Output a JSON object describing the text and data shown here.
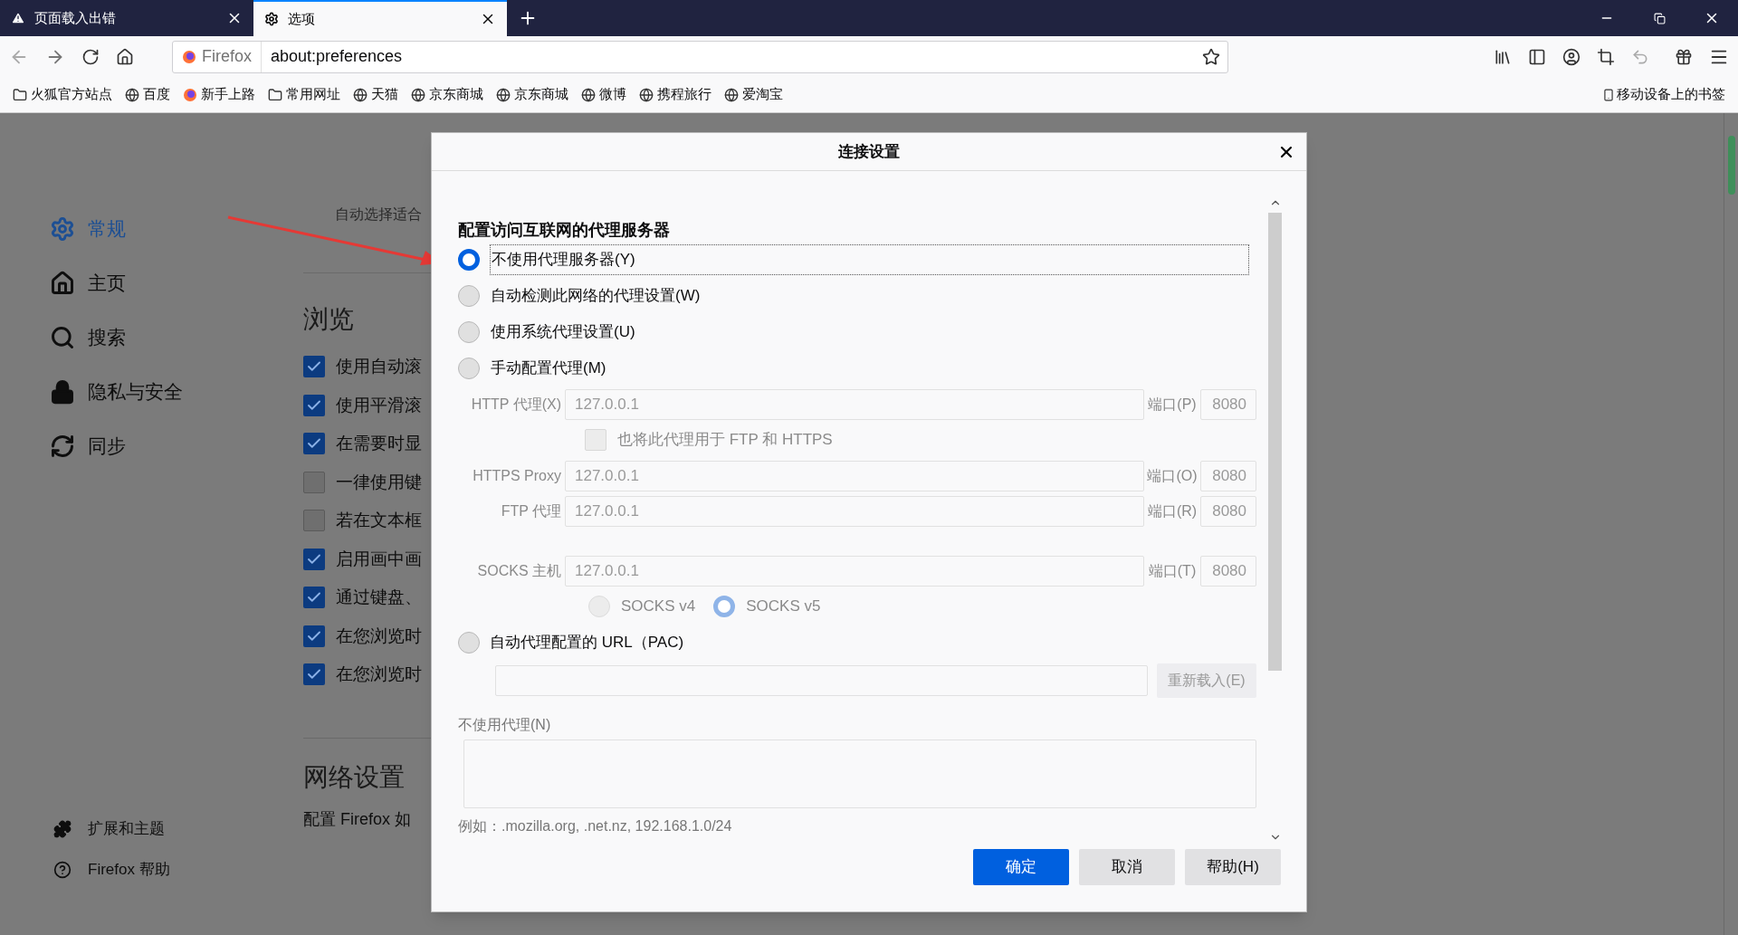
{
  "tabs": [
    {
      "title": "页面载入出错",
      "kind": "warning",
      "selected": false
    },
    {
      "title": "选项",
      "kind": "settings",
      "selected": true
    }
  ],
  "address_bar": {
    "identity": "Firefox",
    "url": "about:preferences"
  },
  "bookmarks": [
    {
      "label": "火狐官方站点",
      "kind": "folder"
    },
    {
      "label": "百度",
      "kind": "globe"
    },
    {
      "label": "新手上路",
      "kind": "firefox"
    },
    {
      "label": "常用网址",
      "kind": "folder"
    },
    {
      "label": "天猫",
      "kind": "globe"
    },
    {
      "label": "京东商城",
      "kind": "globe"
    },
    {
      "label": "京东商城",
      "kind": "globe"
    },
    {
      "label": "微博",
      "kind": "globe"
    },
    {
      "label": "携程旅行",
      "kind": "globe"
    },
    {
      "label": "爱淘宝",
      "kind": "globe"
    }
  ],
  "mobile_bookmarks": "移动设备上的书签",
  "sidebar": {
    "items": [
      {
        "label": "常规",
        "kind": "general",
        "selected": true
      },
      {
        "label": "主页",
        "kind": "home",
        "selected": false
      },
      {
        "label": "搜索",
        "kind": "search",
        "selected": false
      },
      {
        "label": "隐私与安全",
        "kind": "privacy",
        "selected": false
      },
      {
        "label": "同步",
        "kind": "sync",
        "selected": false
      }
    ],
    "footer": [
      {
        "label": "扩展和主题",
        "kind": "extensions"
      },
      {
        "label": "Firefox 帮助",
        "kind": "help"
      }
    ]
  },
  "page": {
    "intro": "自动选择适合",
    "browsing_heading": "浏览",
    "checkboxes": [
      {
        "label": "使用自动滚",
        "checked": true
      },
      {
        "label": "使用平滑滚",
        "checked": true
      },
      {
        "label": "在需要时显",
        "checked": true
      },
      {
        "label": "一律使用键",
        "checked": false
      },
      {
        "label": "若在文本框",
        "checked": false
      },
      {
        "label": "启用画中画",
        "checked": true
      },
      {
        "label": "通过键盘、",
        "checked": true
      },
      {
        "label": "在您浏览时",
        "checked": true
      },
      {
        "label": "在您浏览时",
        "checked": true
      }
    ],
    "network_heading": "网络设置",
    "network_text": "配置 Firefox 如"
  },
  "dialog": {
    "title": "连接设置",
    "heading": "配置访问互联网的代理服务器",
    "modes": [
      {
        "label": "不使用代理服务器(Y)",
        "selected": true
      },
      {
        "label": "自动检测此网络的代理设置(W)",
        "selected": false
      },
      {
        "label": "使用系统代理设置(U)",
        "selected": false
      },
      {
        "label": "手动配置代理(M)",
        "selected": false
      }
    ],
    "manual_disabled": true,
    "proxies": [
      {
        "kind": "http",
        "label": "HTTP 代理(X)",
        "host": "127.0.0.1",
        "port_label": "端口(P)",
        "port": "8080"
      },
      {
        "kind": "https",
        "label": "HTTPS Proxy",
        "host": "127.0.0.1",
        "port_label": "端口(O)",
        "port": "8080"
      },
      {
        "kind": "ftp",
        "label": "FTP 代理",
        "host": "127.0.0.1",
        "port_label": "端口(R)",
        "port": "8080"
      },
      {
        "kind": "socks",
        "label": "SOCKS 主机",
        "host": "127.0.0.1",
        "port_label": "端口(T)",
        "port": "8080"
      }
    ],
    "share_checkbox": {
      "label": "也将此代理用于 FTP 和 HTTPS",
      "checked": false
    },
    "socks_versions": [
      {
        "label": "SOCKS v4",
        "selected": false
      },
      {
        "label": "SOCKS v5",
        "selected": true
      }
    ],
    "pac": {
      "label": "自动代理配置的 URL（PAC)",
      "selected": false,
      "reload_button": "重新载入(E)"
    },
    "no_proxy": {
      "label": "不使用代理(N)",
      "example": "例如：.mozilla.org, .net.nz, 192.168.1.0/24"
    },
    "buttons": [
      {
        "label": "确定",
        "kind": "primary"
      },
      {
        "label": "取消",
        "kind": "normal"
      },
      {
        "label": "帮助(H)",
        "kind": "normal"
      }
    ]
  }
}
